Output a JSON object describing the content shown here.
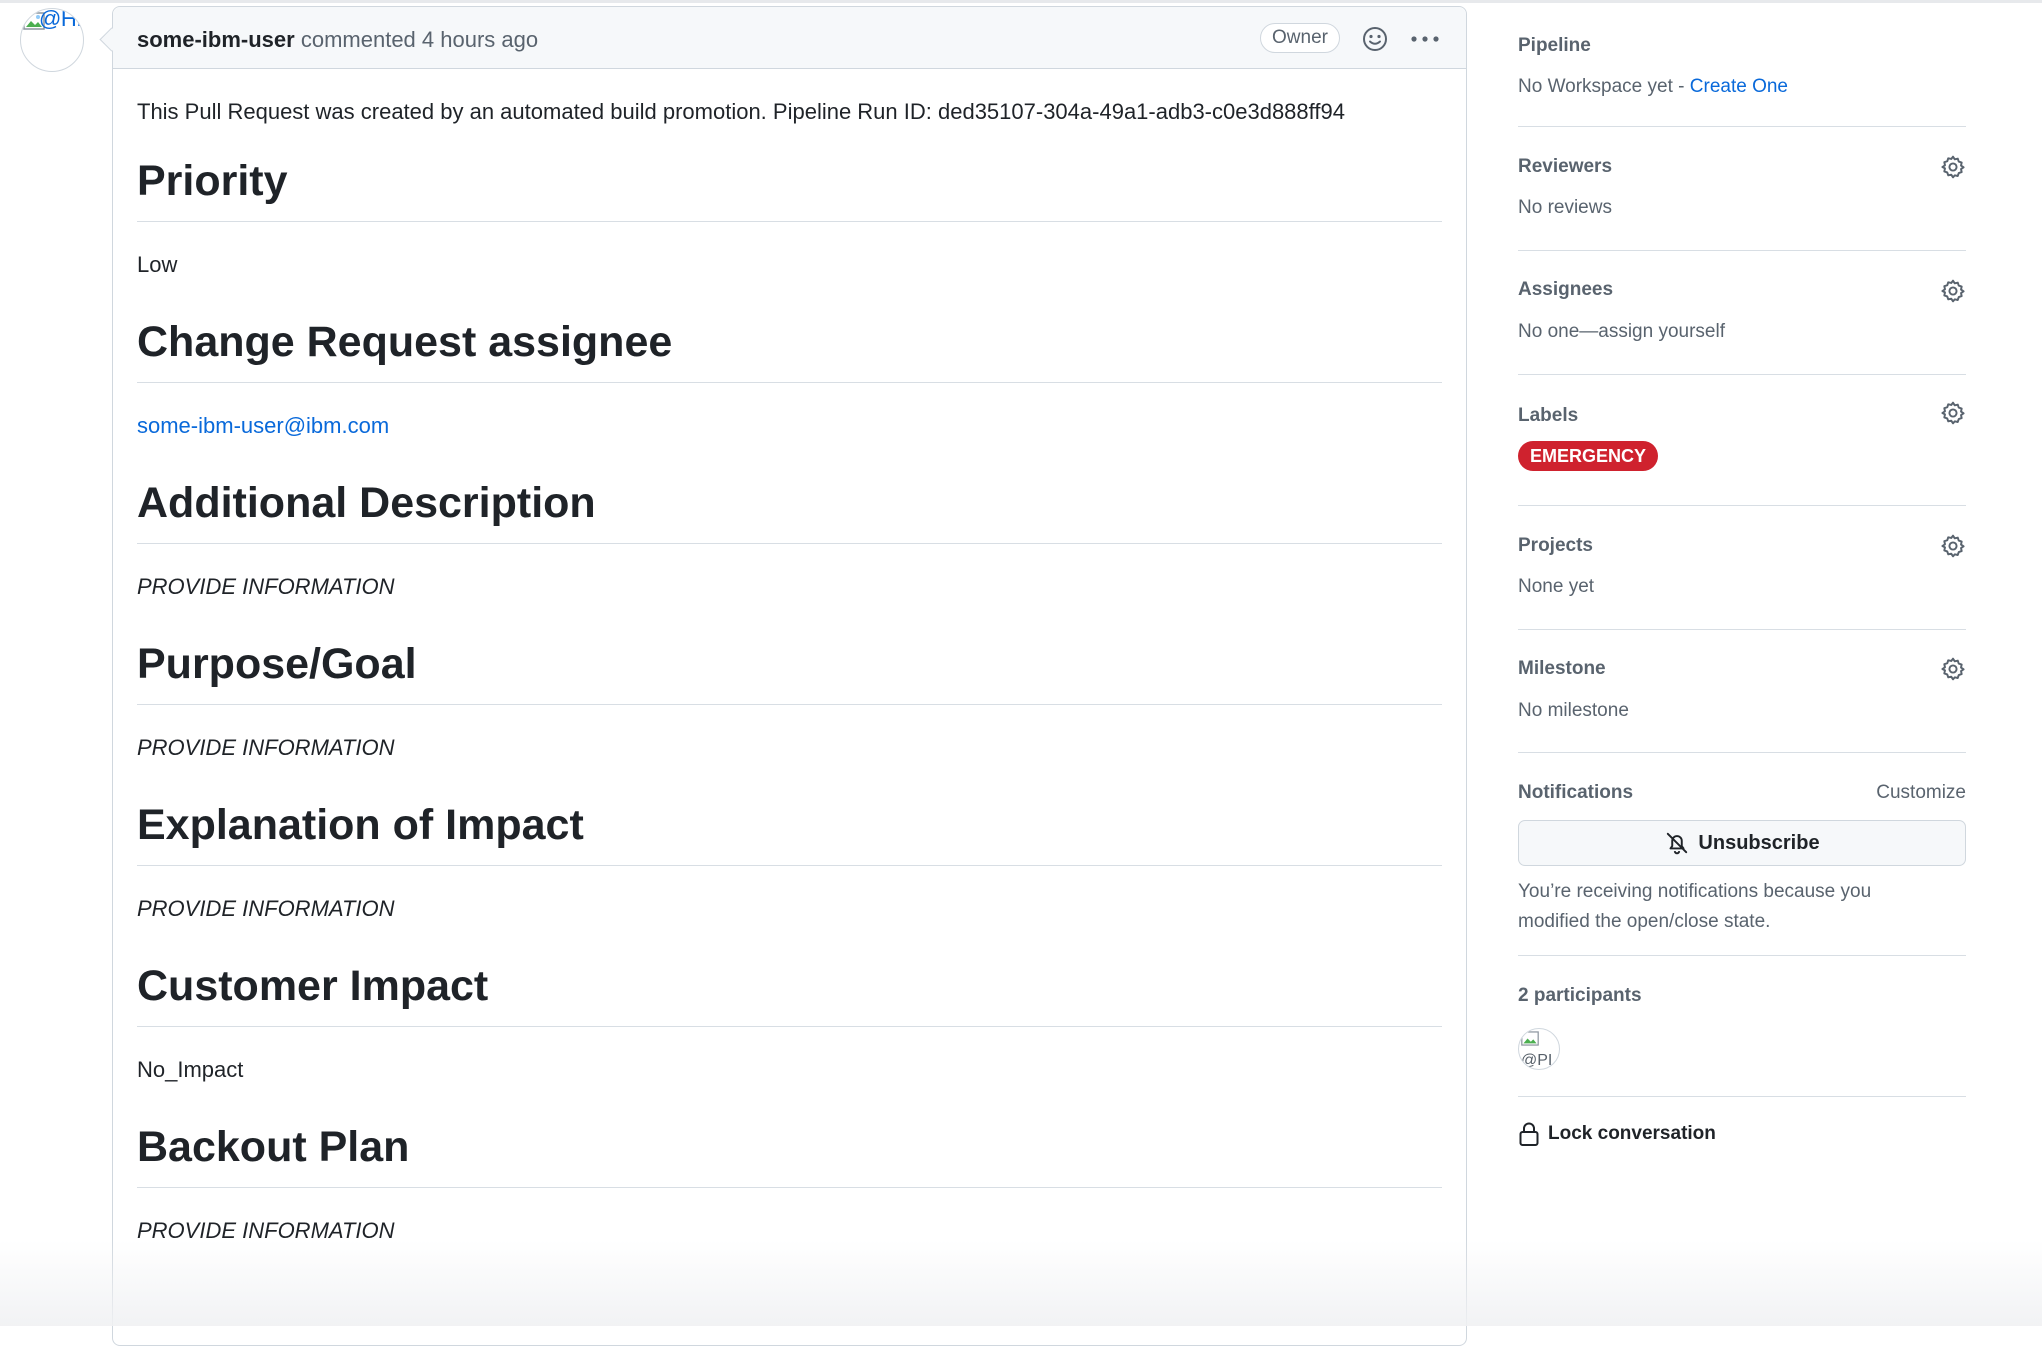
{
  "comment": {
    "avatar_alt": "@HIYUSH-",
    "author": "some-ibm-user",
    "action": "commented",
    "time": "4 hours ago",
    "badge": "Owner",
    "intro": "This Pull Request was created by an automated build promotion. Pipeline Run ID: ded35107-304a-49a1-adb3-c0e3d888ff94",
    "sections": [
      {
        "heading": "Priority",
        "value": "Low"
      },
      {
        "heading": "Change Request assignee",
        "value": "some-ibm-user@ibm.com"
      },
      {
        "heading": "Additional Description",
        "value": "PROVIDE INFORMATION"
      },
      {
        "heading": "Purpose/Goal",
        "value": "PROVIDE INFORMATION"
      },
      {
        "heading": "Explanation of Impact",
        "value": "PROVIDE INFORMATION"
      },
      {
        "heading": "Customer Impact",
        "value": "No_Impact"
      },
      {
        "heading": "Backout Plan",
        "value": "PROVIDE INFORMATION"
      }
    ]
  },
  "sidebar": {
    "pipeline": {
      "title": "Pipeline",
      "text": "No Workspace yet - ",
      "link": "Create One"
    },
    "reviewers": {
      "title": "Reviewers",
      "text": "No reviews"
    },
    "assignees": {
      "title": "Assignees",
      "text": "No one—assign yourself"
    },
    "labels": {
      "title": "Labels",
      "label": "EMERGENCY",
      "label_color": "#cf222e"
    },
    "projects": {
      "title": "Projects",
      "text": "None yet"
    },
    "milestone": {
      "title": "Milestone",
      "text": "No milestone"
    },
    "notifications": {
      "title": "Notifications",
      "customize": "Customize",
      "button": "Unsubscribe",
      "reason_line1": "You’re receiving notifications because you",
      "reason_line2": "modified the open/close state."
    },
    "participants": {
      "title": "2 participants",
      "avatar_alt": "@PI"
    },
    "lock": {
      "label": "Lock conversation"
    }
  },
  "icons": [
    "smiley-icon",
    "kebab-horizontal-icon",
    "gear-icon",
    "bell-slash-icon",
    "lock-icon",
    "broken-image-icon"
  ]
}
